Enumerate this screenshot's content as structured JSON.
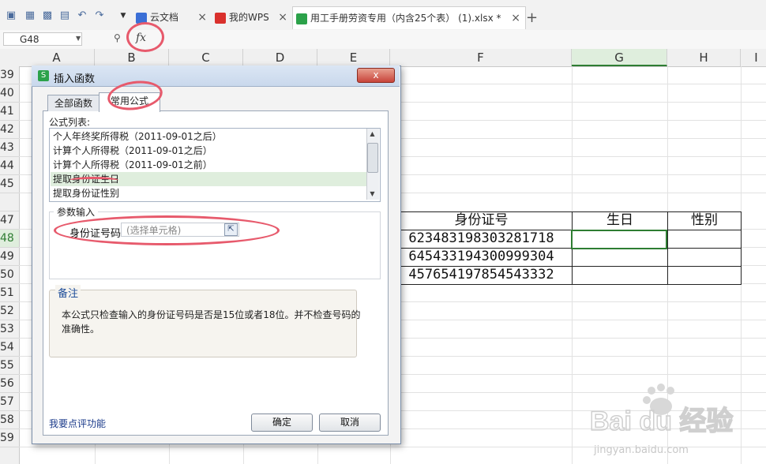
{
  "toolbar": {
    "tabs": [
      {
        "label": "云文档",
        "icon": "cloud-doc-icon",
        "icon_color": "#3b6fd6"
      },
      {
        "label": "我的WPS",
        "icon": "wps-logo-icon",
        "icon_color": "#d9302c"
      },
      {
        "label": "用工手册劳资专用（内含25个表） (1).xlsx *",
        "icon": "sheet-icon",
        "icon_color": "#2ca24a"
      }
    ],
    "new_tab": "+"
  },
  "formula_bar": {
    "cell_ref": "G48",
    "fx": "fx"
  },
  "columns": [
    "A",
    "B",
    "C",
    "D",
    "E",
    "F",
    "G",
    "H",
    "I"
  ],
  "rows": [
    "39",
    "40",
    "41",
    "42",
    "43",
    "44",
    "45",
    "47",
    "48",
    "49",
    "50",
    "51",
    "52",
    "53",
    "54",
    "55",
    "56",
    "57",
    "58",
    "59"
  ],
  "sheet_table": {
    "headers": [
      "身份证号",
      "生日",
      "性别"
    ],
    "rows": [
      [
        "623483198303281718",
        "",
        ""
      ],
      [
        "645433194300999304",
        "",
        ""
      ],
      [
        "457654197854543332",
        "",
        ""
      ]
    ]
  },
  "dialog": {
    "title": "插入函数",
    "close": "x",
    "tabs": [
      "全部函数",
      "常用公式"
    ],
    "list_label": "公式列表:",
    "formulas": [
      "个人年终奖所得税（2011-09-01之后）",
      "计算个人所得税（2011-09-01之后）",
      "计算个人所得税（2011-09-01之前）",
      "提取身份证生日",
      "提取身份证性别"
    ],
    "selected_index": 3,
    "params_label": "参数输入",
    "param_name": "身份证号码",
    "param_placeholder": "(选择单元格)",
    "note_label": "备注",
    "note_text": "本公式只检查输入的身份证号码是否是15位或者18位。并不检查号码的准确性。",
    "review_link": "我要点评功能",
    "ok": "确定",
    "cancel": "取消"
  },
  "watermark": {
    "brand": "Bai du 经验",
    "url": "jingyan.baidu.com"
  }
}
